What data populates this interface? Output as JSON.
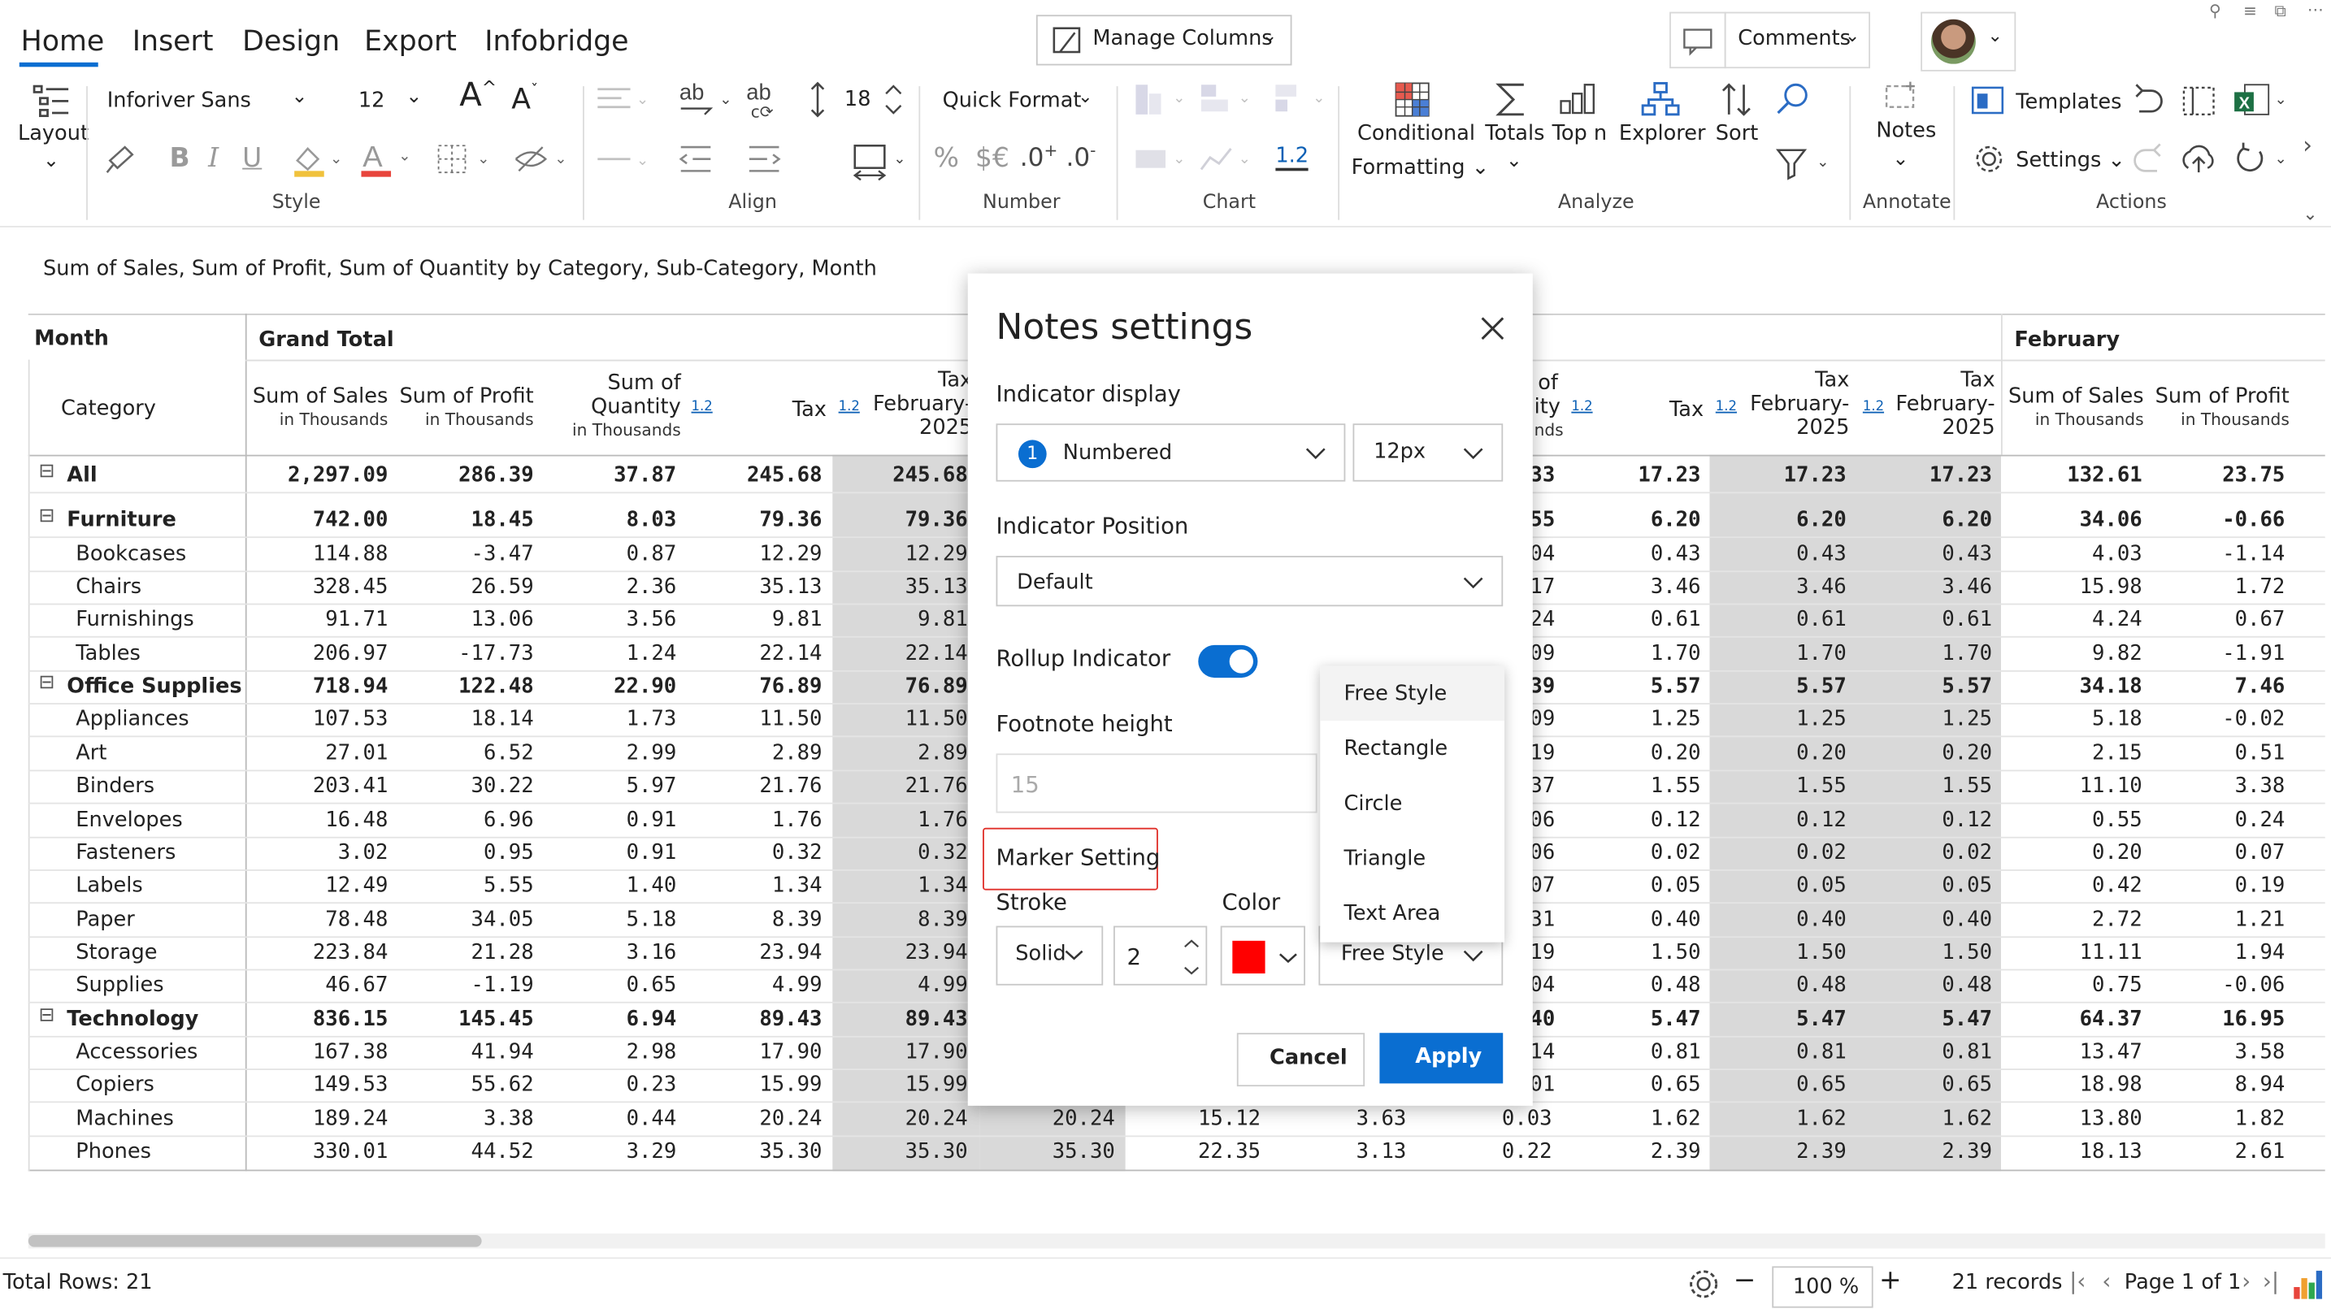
{
  "ribbon": {
    "tabs": [
      "Home",
      "Insert",
      "Design",
      "Export",
      "Infobridge"
    ],
    "manage_columns": "Manage Columns",
    "comments": "Comments",
    "layout_label": "Layout",
    "font_name": "Inforiver Sans",
    "font_size": "12",
    "line_height": "18",
    "quick_format": "Quick Format",
    "decimal_label": "1.2",
    "conditional_formatting": [
      "Conditional",
      "Formatting"
    ],
    "totals": "Totals",
    "topn": "Top n",
    "explorer": "Explorer",
    "sort": "Sort",
    "notes": "Notes",
    "templates": "Templates",
    "settings": "Settings",
    "sections": {
      "style": "Style",
      "align": "Align",
      "number": "Number",
      "chart": "Chart",
      "analyze": "Analyze",
      "annotate": "Annotate",
      "actions": "Actions"
    }
  },
  "report": {
    "title": "Sum of Sales, Sum of Profit, Sum of Quantity by Category, Sub-Category, Month",
    "month_label": "Month",
    "category_label": "Category",
    "grand_total": "Grand Total",
    "february": "February",
    "headers": {
      "sales": "Sum of Sales",
      "profit": "Sum of Profit",
      "qty1": "Sum of",
      "qty2": "Quantity",
      "thousands": "in Thousands",
      "tax": "Tax",
      "tax_feb1": "Tax",
      "tax_feb2": "February-",
      "tax_feb3": "2025",
      "of": "of",
      "ity": "ity",
      "nds": "nds",
      "badge": "1.2"
    },
    "rows": [
      {
        "name": "All",
        "level": 0,
        "bold": true,
        "exp": "⊟",
        "c": [
          "2,297.09",
          "286.39",
          "37.87",
          "245.68",
          "245.68"
        ],
        "r": [
          "33",
          "17.23",
          "17.23",
          "17.23",
          "132.61",
          "23.75"
        ]
      },
      {
        "name": "Furniture",
        "level": 0,
        "bold": true,
        "exp": "⊟",
        "c": [
          "742.00",
          "18.45",
          "8.03",
          "79.36",
          "79.36"
        ],
        "r": [
          "55",
          "6.20",
          "6.20",
          "6.20",
          "34.06",
          "-0.66"
        ]
      },
      {
        "name": "Bookcases",
        "level": 1,
        "c": [
          "114.88",
          "-3.47",
          "0.87",
          "12.29",
          "12.29"
        ],
        "r": [
          "04",
          "0.43",
          "0.43",
          "0.43",
          "4.03",
          "-1.14"
        ]
      },
      {
        "name": "Chairs",
        "level": 1,
        "c": [
          "328.45",
          "26.59",
          "2.36",
          "35.13",
          "35.13"
        ],
        "r": [
          "17",
          "3.46",
          "3.46",
          "3.46",
          "15.98",
          "1.72"
        ]
      },
      {
        "name": "Furnishings",
        "level": 1,
        "c": [
          "91.71",
          "13.06",
          "3.56",
          "9.81",
          "9.81"
        ],
        "r": [
          "24",
          "0.61",
          "0.61",
          "0.61",
          "4.24",
          "0.67"
        ]
      },
      {
        "name": "Tables",
        "level": 1,
        "c": [
          "206.97",
          "-17.73",
          "1.24",
          "22.14",
          "22.14"
        ],
        "r": [
          "09",
          "1.70",
          "1.70",
          "1.70",
          "9.82",
          "-1.91"
        ]
      },
      {
        "name": "Office Supplies",
        "level": 0,
        "bold": true,
        "exp": "⊟",
        "c": [
          "718.94",
          "122.48",
          "22.90",
          "76.89",
          "76.89"
        ],
        "r": [
          "39",
          "5.57",
          "5.57",
          "5.57",
          "34.18",
          "7.46"
        ]
      },
      {
        "name": "Appliances",
        "level": 1,
        "c": [
          "107.53",
          "18.14",
          "1.73",
          "11.50",
          "11.50"
        ],
        "r": [
          "09",
          "1.25",
          "1.25",
          "1.25",
          "5.18",
          "-0.02"
        ]
      },
      {
        "name": "Art",
        "level": 1,
        "c": [
          "27.01",
          "6.52",
          "2.99",
          "2.89",
          "2.89"
        ],
        "r": [
          "19",
          "0.20",
          "0.20",
          "0.20",
          "2.15",
          "0.51"
        ]
      },
      {
        "name": "Binders",
        "level": 1,
        "c": [
          "203.41",
          "30.22",
          "5.97",
          "21.76",
          "21.76"
        ],
        "r": [
          "37",
          "1.55",
          "1.55",
          "1.55",
          "11.10",
          "3.38"
        ]
      },
      {
        "name": "Envelopes",
        "level": 1,
        "c": [
          "16.48",
          "6.96",
          "0.91",
          "1.76",
          "1.76"
        ],
        "r": [
          "06",
          "0.12",
          "0.12",
          "0.12",
          "0.55",
          "0.24"
        ]
      },
      {
        "name": "Fasteners",
        "level": 1,
        "c": [
          "3.02",
          "0.95",
          "0.91",
          "0.32",
          "0.32"
        ],
        "r": [
          "06",
          "0.02",
          "0.02",
          "0.02",
          "0.20",
          "0.07"
        ]
      },
      {
        "name": "Labels",
        "level": 1,
        "c": [
          "12.49",
          "5.55",
          "1.40",
          "1.34",
          "1.34"
        ],
        "r": [
          "07",
          "0.05",
          "0.05",
          "0.05",
          "0.42",
          "0.19"
        ]
      },
      {
        "name": "Paper",
        "level": 1,
        "c": [
          "78.48",
          "34.05",
          "5.18",
          "8.39",
          "8.39"
        ],
        "r": [
          "31",
          "0.40",
          "0.40",
          "0.40",
          "2.72",
          "1.21"
        ]
      },
      {
        "name": "Storage",
        "level": 1,
        "c": [
          "223.84",
          "21.28",
          "3.16",
          "23.94",
          "23.94"
        ],
        "r": [
          "19",
          "1.50",
          "1.50",
          "1.50",
          "11.11",
          "1.94"
        ]
      },
      {
        "name": "Supplies",
        "level": 1,
        "c": [
          "46.67",
          "-1.19",
          "0.65",
          "4.99",
          "4.99"
        ],
        "r": [
          "04",
          "0.48",
          "0.48",
          "0.48",
          "0.75",
          "-0.06"
        ]
      },
      {
        "name": "Technology",
        "level": 0,
        "bold": true,
        "exp": "⊟",
        "c": [
          "836.15",
          "145.45",
          "6.94",
          "89.43",
          "89.43"
        ],
        "r": [
          "40",
          "5.47",
          "5.47",
          "5.47",
          "64.37",
          "16.95"
        ]
      },
      {
        "name": "Accessories",
        "level": 1,
        "c": [
          "167.38",
          "41.94",
          "2.98",
          "17.90",
          "17.90"
        ],
        "r": [
          "14",
          "0.81",
          "0.81",
          "0.81",
          "13.47",
          "3.58"
        ]
      },
      {
        "name": "Copiers",
        "level": 1,
        "c": [
          "149.53",
          "55.62",
          "0.23",
          "15.99",
          "15.99"
        ],
        "r": [
          "01",
          "0.65",
          "0.65",
          "0.65",
          "18.98",
          "8.94"
        ]
      },
      {
        "name": "Machines",
        "level": 1,
        "c": [
          "189.24",
          "3.38",
          "0.44",
          "20.24",
          "20.24"
        ],
        "m": [
          "20.24",
          "15.12",
          "3.63",
          "0.03"
        ],
        "r": [
          "",
          "1.62",
          "1.62",
          "1.62",
          "13.80",
          "1.82"
        ]
      },
      {
        "name": "Phones",
        "level": 1,
        "c": [
          "330.01",
          "44.52",
          "3.29",
          "35.30",
          "35.30"
        ],
        "m": [
          "35.30",
          "22.35",
          "3.13",
          "0.22"
        ],
        "r": [
          "",
          "2.39",
          "2.39",
          "2.39",
          "18.13",
          "2.61"
        ]
      }
    ]
  },
  "dialog": {
    "title": "Notes settings",
    "indicator_display": "Indicator display",
    "indicator_badge": "1",
    "indicator_value": "Numbered",
    "indicator_size": "12px",
    "indicator_position": "Indicator Position",
    "position_value": "Default",
    "rollup_indicator": "Rollup Indicator",
    "footnote_height": "Footnote height",
    "footnote_placeholder": "15",
    "marker_setting": "Marker Setting",
    "stroke": "Stroke",
    "stroke_value": "Solid",
    "stroke_width": "2",
    "color": "Color",
    "color_value": "#ff0000",
    "shape_value": "Free Style",
    "shape_options": [
      "Free Style",
      "Rectangle",
      "Circle",
      "Triangle",
      "Text Area"
    ],
    "cancel": "Cancel",
    "apply": "Apply"
  },
  "status": {
    "total_rows": "Total Rows: 21",
    "zoom": "100 %",
    "records": "21 records",
    "page": "Page 1 of 1"
  },
  "colors": {
    "accent": "#0a6ed1",
    "tab_underline": "#0a6ed1",
    "highlight": "#d9d9d9",
    "marker_outline": "#e0302a"
  }
}
